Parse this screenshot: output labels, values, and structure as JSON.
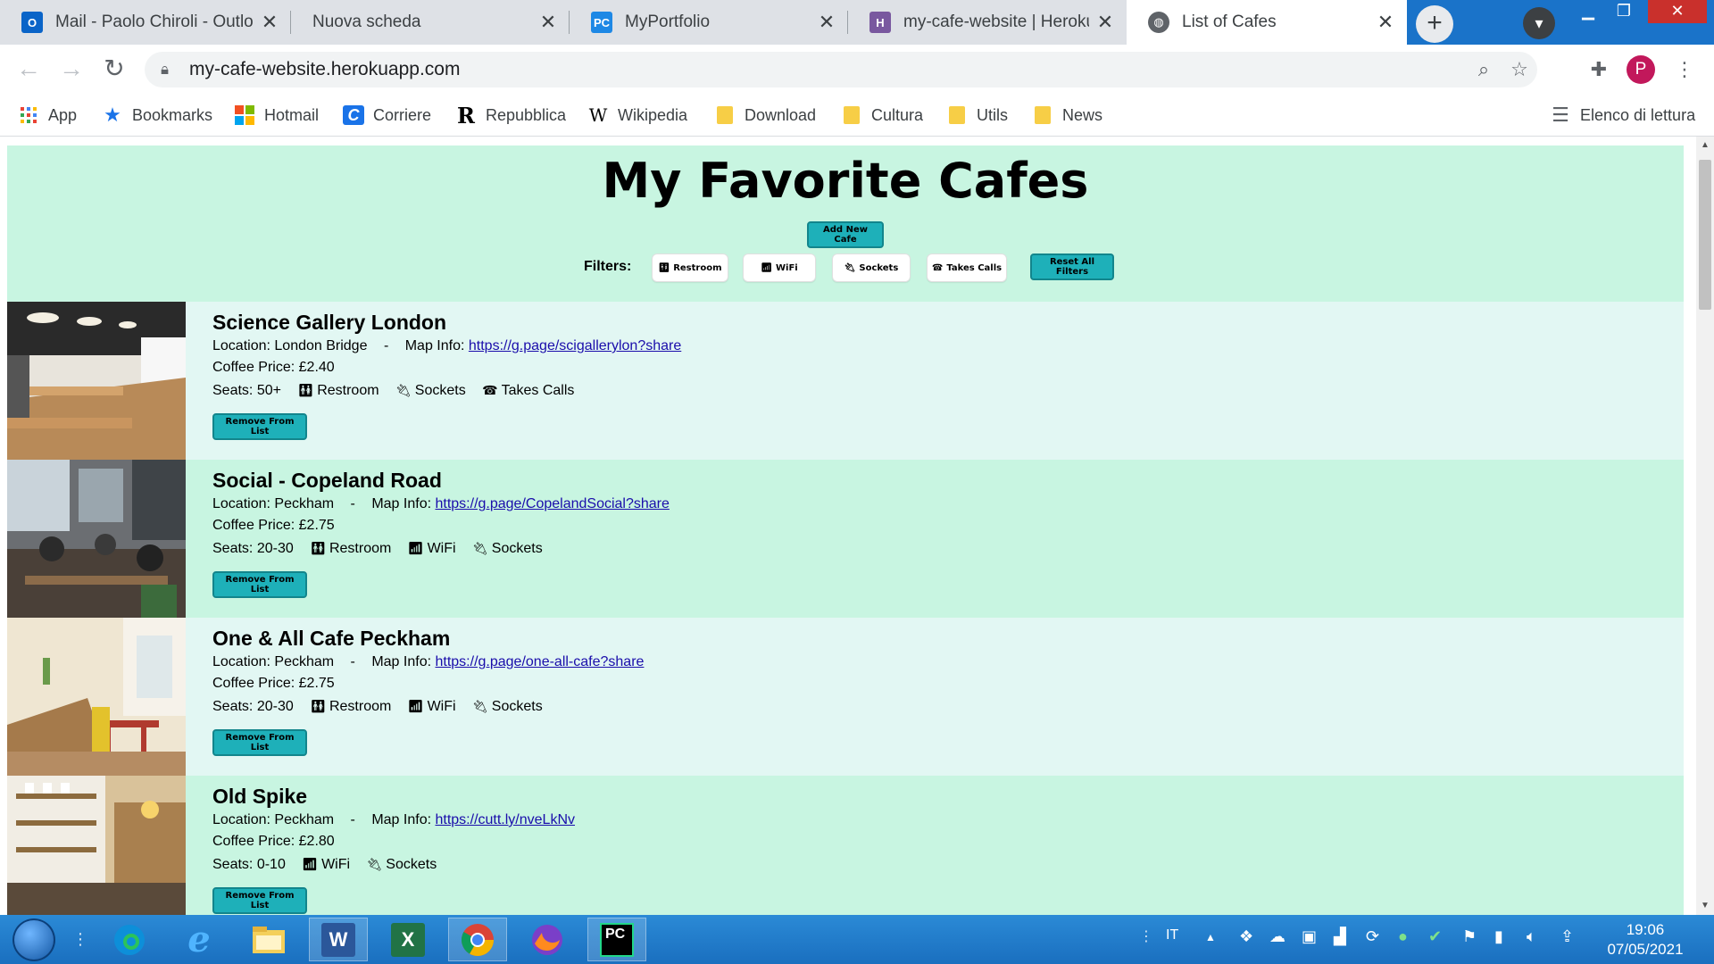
{
  "browser": {
    "tabs": [
      {
        "title": "Mail - Paolo Chiroli - Outlo",
        "icon": "outlook-icon"
      },
      {
        "title": "Nuova scheda",
        "icon": "none"
      },
      {
        "title": "MyPortfolio",
        "icon": "pycharm-icon"
      },
      {
        "title": "my-cafe-website | Heroku",
        "icon": "heroku-icon"
      },
      {
        "title": "List of Cafes",
        "icon": "globe-icon"
      }
    ],
    "url": "my-cafe-website.herokuapp.com",
    "profile_initial": "P",
    "bookmarks": [
      "App",
      "Bookmarks",
      "Hotmail",
      "Corriere",
      "Repubblica",
      "Wikipedia",
      "Download",
      "Cultura",
      "Utils",
      "News"
    ],
    "reading_list": "Elenco di lettura"
  },
  "page": {
    "title": "My Favorite Cafes",
    "add_button": "Add New Cafe",
    "filters_label": "Filters:",
    "filters": [
      {
        "label": "Restroom",
        "icon": "restroom-icon"
      },
      {
        "label": "WiFi",
        "icon": "wifi-icon"
      },
      {
        "label": "Sockets",
        "icon": "plug-icon"
      },
      {
        "label": "Takes Calls",
        "icon": "phone-icon"
      }
    ],
    "reset_button": "Reset All Filters",
    "remove_label": "Remove From List",
    "location_prefix": "Location:",
    "map_prefix": "Map Info:",
    "price_prefix": "Coffee Price:",
    "seats_prefix": "Seats:",
    "cafes": [
      {
        "name": "Science Gallery London",
        "location": "London Bridge",
        "map_url": "https://g.page/scigallerylon?share",
        "price": "£2.40",
        "seats": "50+",
        "amenities": [
          "Restroom",
          "Sockets",
          "Takes Calls"
        ]
      },
      {
        "name": "Social - Copeland Road",
        "location": "Peckham",
        "map_url": "https://g.page/CopelandSocial?share",
        "price": "£2.75",
        "seats": "20-30",
        "amenities": [
          "Restroom",
          "WiFi",
          "Sockets"
        ]
      },
      {
        "name": "One & All Cafe Peckham",
        "location": "Peckham",
        "map_url": "https://g.page/one-all-cafe?share",
        "price": "£2.75",
        "seats": "20-30",
        "amenities": [
          "Restroom",
          "WiFi",
          "Sockets"
        ]
      },
      {
        "name": "Old Spike",
        "location": "Peckham",
        "map_url": "https://cutt.ly/nveLkNv",
        "price": "£2.80",
        "seats": "0-10",
        "amenities": [
          "WiFi",
          "Sockets"
        ]
      }
    ]
  },
  "taskbar": {
    "language": "IT",
    "time": "19:06",
    "date": "07/05/2021"
  }
}
